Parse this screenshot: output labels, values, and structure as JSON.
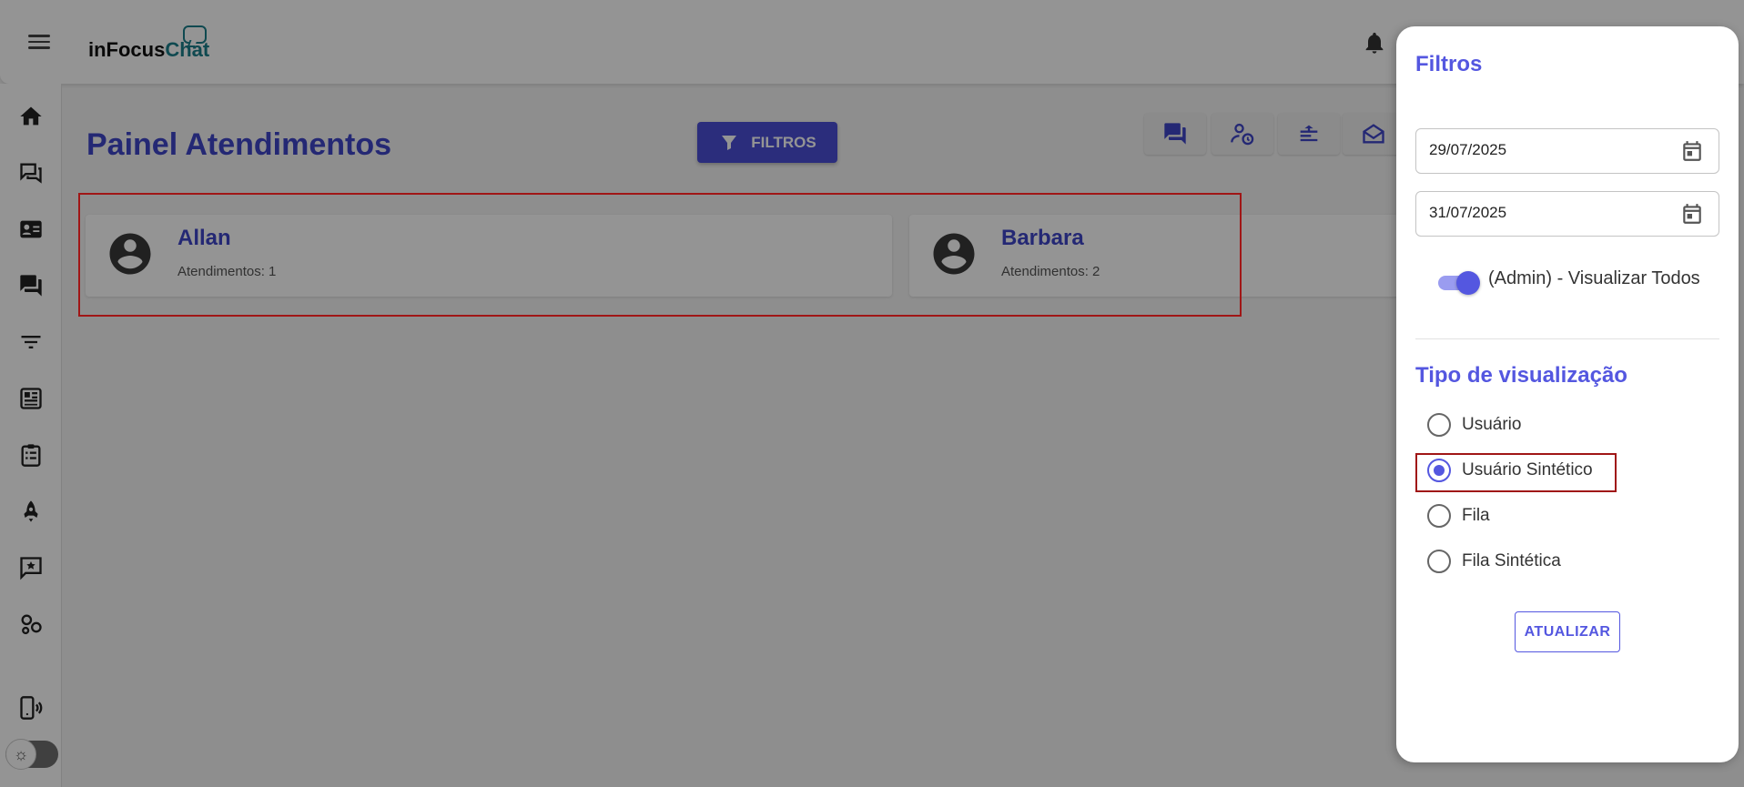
{
  "header": {
    "logo_part1": "inFocus",
    "logo_part2": "Chat",
    "menu_icon": "hamburger-menu-icon",
    "notifications_icon": "bell-icon"
  },
  "sidebar": {
    "items": [
      {
        "name": "home-icon"
      },
      {
        "name": "chat-bubbles-icon"
      },
      {
        "name": "contact-card-icon"
      },
      {
        "name": "forum-icon"
      },
      {
        "name": "filter-lines-icon"
      },
      {
        "name": "dashboard-icon"
      },
      {
        "name": "clipboard-list-icon"
      },
      {
        "name": "rocket-icon"
      },
      {
        "name": "announcement-icon"
      },
      {
        "name": "group-icon"
      },
      {
        "name": "phone-connection-icon"
      }
    ],
    "theme_toggle_icon": "sun-icon"
  },
  "main": {
    "title": "Painel Atendimentos",
    "filter_button": "FILTROS",
    "toolbar": [
      {
        "name": "chat-icon"
      },
      {
        "name": "person-clock-icon"
      },
      {
        "name": "queue-icon"
      },
      {
        "name": "open-mail-icon"
      }
    ],
    "cards": [
      {
        "name": "Allan",
        "count_label": "Atendimentos: 1"
      },
      {
        "name": "Barbara",
        "count_label": "Atendimentos: 2"
      }
    ]
  },
  "drawer": {
    "title": "Filtros",
    "date_start": "29/07/2025",
    "date_end": "31/07/2025",
    "switch_label": "(Admin) - Visualizar Todos",
    "switch_on": true,
    "section_title": "Tipo de visualização",
    "options": [
      {
        "label": "Usuário",
        "checked": false
      },
      {
        "label": "Usuário Sintético",
        "checked": true
      },
      {
        "label": "Fila",
        "checked": false
      },
      {
        "label": "Fila Sintética",
        "checked": false
      }
    ],
    "update_button": "ATUALIZAR"
  },
  "colors": {
    "primary": "#3f45c8",
    "accent": "#5457e0",
    "highlight": "#a01616"
  }
}
